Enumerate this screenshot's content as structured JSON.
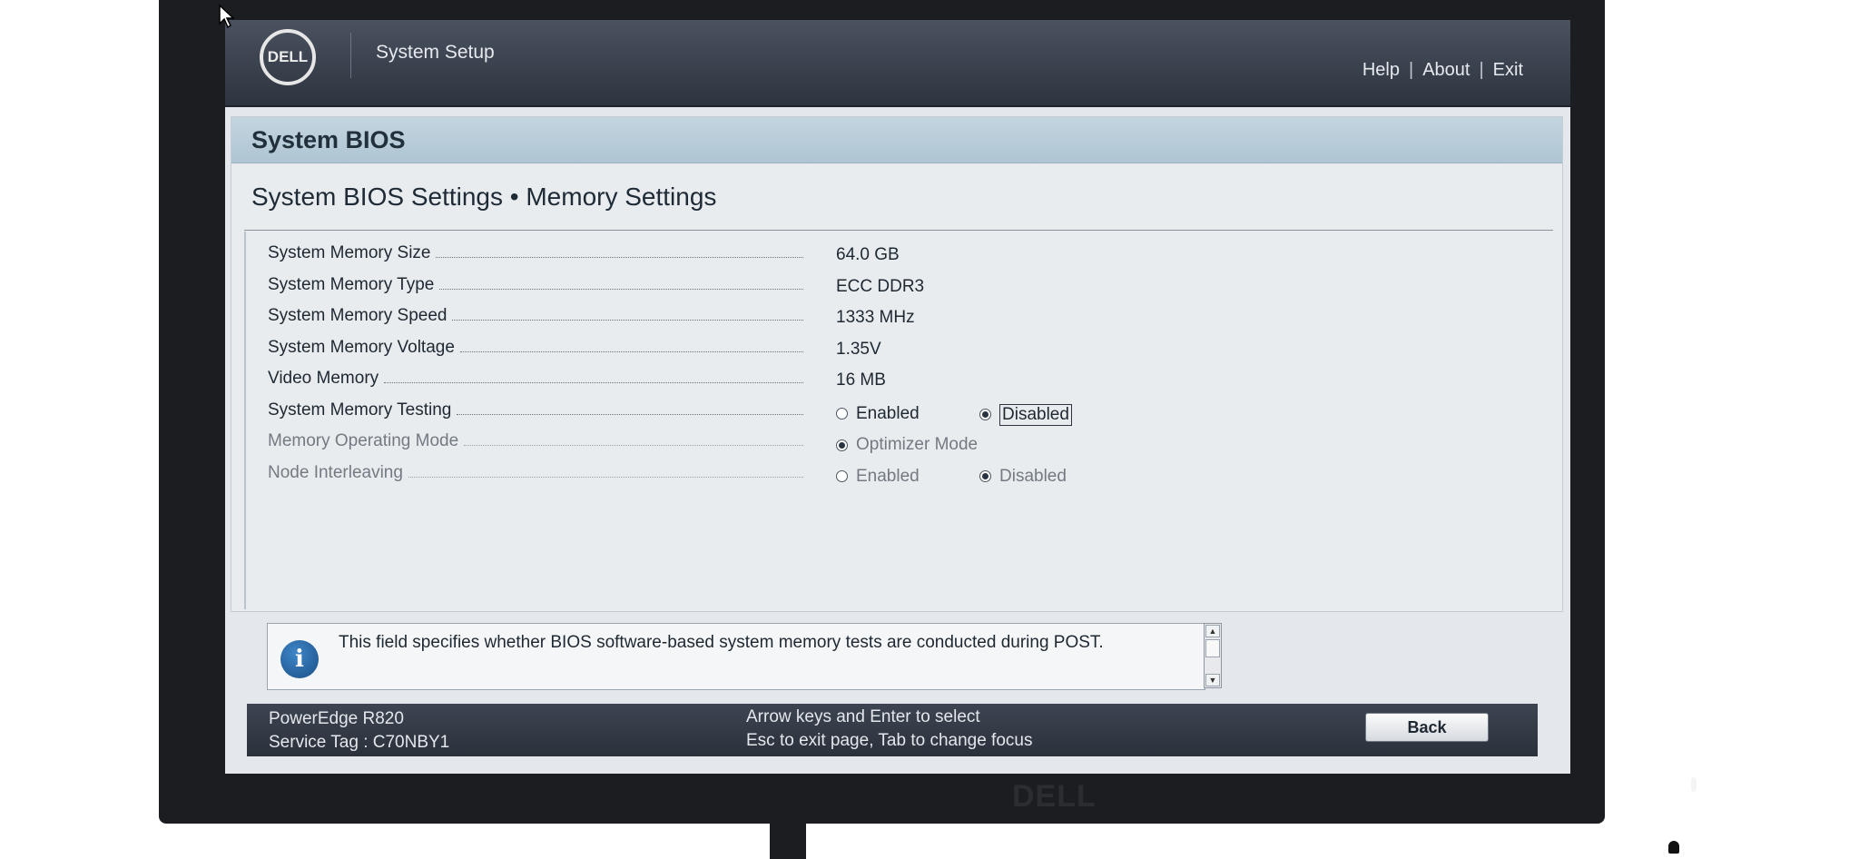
{
  "topbar": {
    "logo_text": "DELL",
    "title": "System Setup",
    "nav": [
      "Help",
      "About",
      "Exit"
    ]
  },
  "section": {
    "title": "System BIOS",
    "subtitle": "System BIOS Settings • Memory Settings"
  },
  "settings": [
    {
      "label": "System Memory Size",
      "value": "64.0 GB"
    },
    {
      "label": "System Memory Type",
      "value": "ECC DDR3"
    },
    {
      "label": "System Memory Speed",
      "value": "1333 MHz"
    },
    {
      "label": "System Memory Voltage",
      "value": "1.35V"
    },
    {
      "label": "Video Memory",
      "value": "16 MB"
    },
    {
      "label": "System Memory Testing",
      "options": [
        "Enabled",
        "Disabled"
      ],
      "selected": "Disabled"
    },
    {
      "label": "Memory Operating Mode",
      "options": [
        "Optimizer Mode"
      ],
      "selected": "Optimizer Mode"
    },
    {
      "label": "Node Interleaving",
      "options": [
        "Enabled",
        "Disabled"
      ],
      "selected": "Disabled"
    }
  ],
  "help": {
    "text": "This field specifies whether BIOS software-based system memory tests are conducted during POST.",
    "icon": "info-icon"
  },
  "footer": {
    "model": "PowerEdge R820",
    "service_tag": "Service Tag : C70NBY1",
    "hint_line1": "Arrow keys and Enter to select",
    "hint_line2": "Esc to exit page, Tab to change focus",
    "back_label": "Back"
  },
  "monitor": {
    "bezel_logo": "DELL"
  },
  "colors": {
    "topbar": "#2d343f",
    "section_header": "#aec5d3",
    "content_bg": "#e9ecef",
    "footer": "#2a313b",
    "info_icon": "#1a4f85"
  }
}
